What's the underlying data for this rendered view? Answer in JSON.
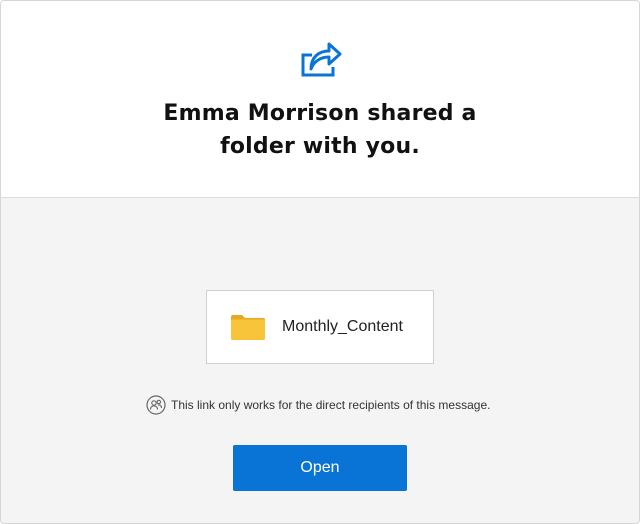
{
  "header": {
    "icon": "share-arrow-icon",
    "title_line1": "Emma Morrison shared a",
    "title_line2": "folder with you."
  },
  "file": {
    "icon": "folder-icon",
    "name": "Monthly_Content"
  },
  "notice": {
    "icon": "recipients-icon",
    "text": "This link only works for the direct recipients of this message."
  },
  "actions": {
    "open_label": "Open"
  },
  "colors": {
    "accent": "#0A74D6",
    "folder": "#F8C53A",
    "background": "#F4F4F4"
  }
}
